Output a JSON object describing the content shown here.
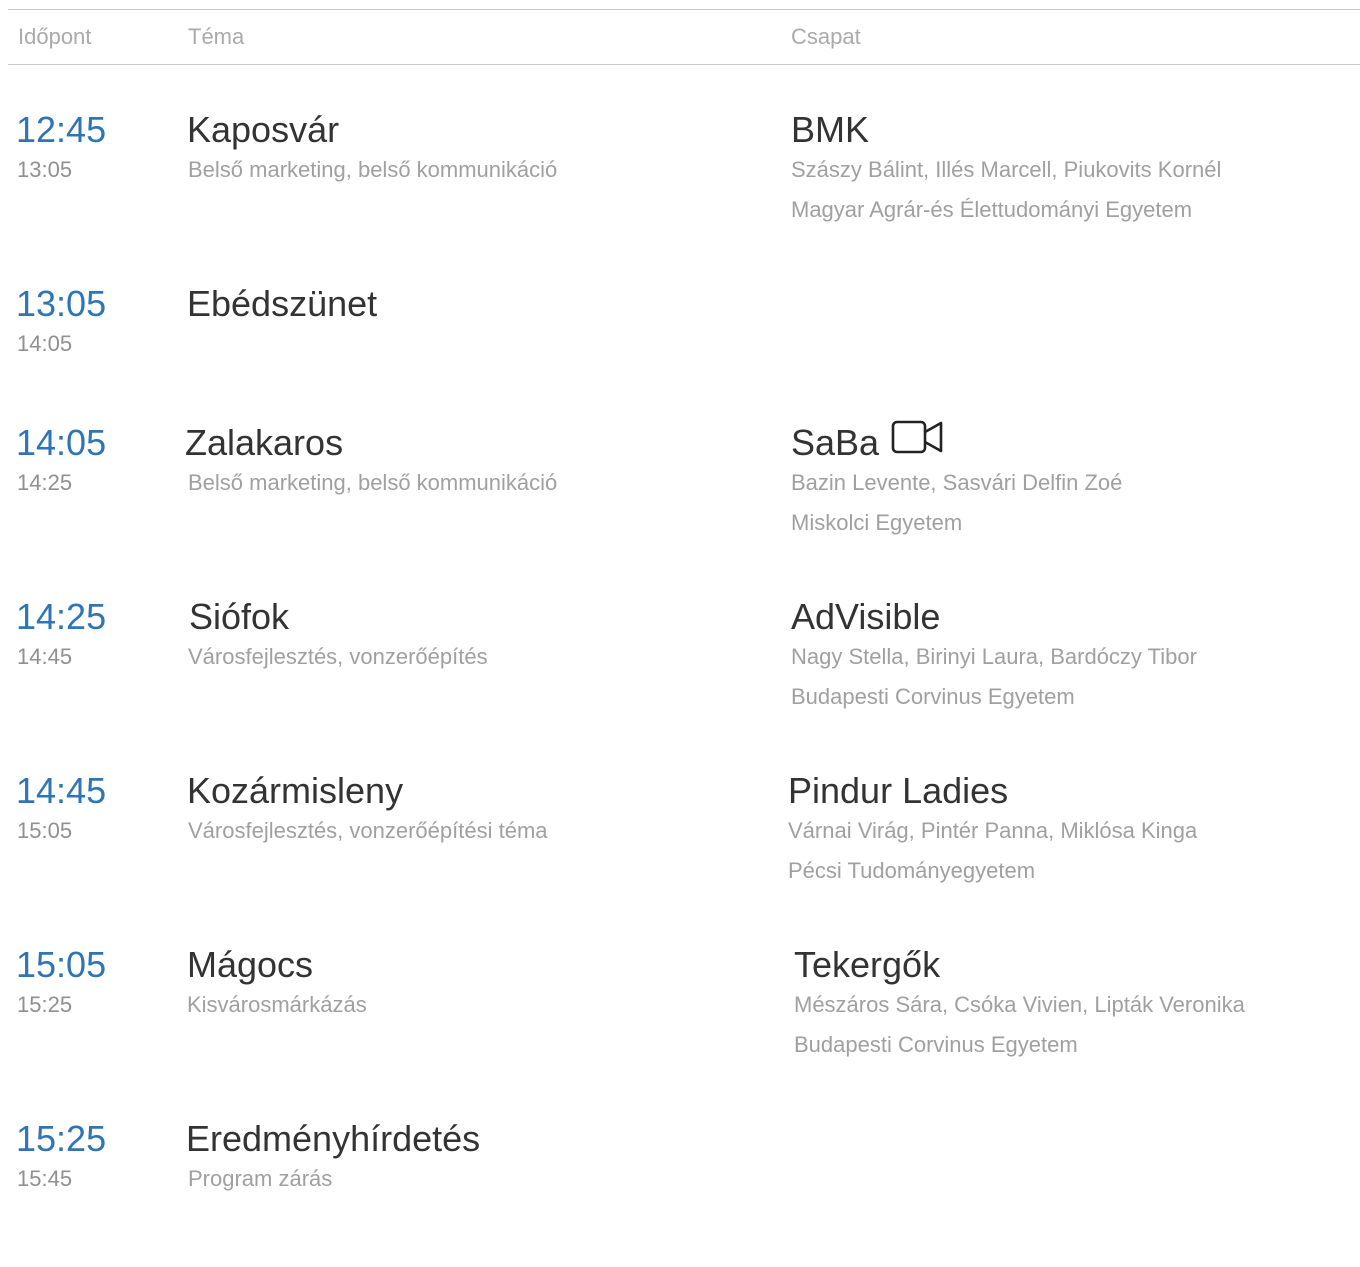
{
  "header": {
    "time_label": "Időpont",
    "topic_label": "Téma",
    "team_label": "Csapat"
  },
  "rows": [
    {
      "start": "12:45",
      "end": "13:05",
      "title": "Kaposvár",
      "subtitle": "Belső marketing, belső kommunikáció",
      "team": "BMK",
      "members": "Szászy Bálint, Illés Marcell,  Piukovits Kornél",
      "university": "Magyar Agrár-és Élettudományi Egyetem"
    },
    {
      "start": "13:05",
      "end": "14:05",
      "title": "Ebédszünet"
    },
    {
      "start": "14:05",
      "end": "14:25",
      "title": "Zalakaros",
      "subtitle": "Belső marketing, belső kommunikáció",
      "team": "SaBa",
      "team_icon": "video-camera-icon",
      "members": "Bazin Levente, Sasvári Delfin Zoé",
      "university": "Miskolci Egyetem"
    },
    {
      "start": "14:25",
      "end": "14:45",
      "title": "Siófok",
      "subtitle": "Városfejlesztés, vonzerőépítés",
      "team": "AdVisible",
      "members": "Nagy Stella, Birinyi Laura, Bardóczy Tibor",
      "university": "Budapesti Corvinus Egyetem"
    },
    {
      "start": "14:45",
      "end": "15:05",
      "title": "Kozármisleny",
      "subtitle": "Városfejlesztés, vonzerőépítési téma",
      "team": "Pindur Ladies",
      "members": "Várnai Virág, Pintér Panna, Miklósa Kinga",
      "university": "Pécsi Tudományegyetem"
    },
    {
      "start": "15:05",
      "end": "15:25",
      "title": "Mágocs",
      "subtitle": "Kisvárosmárkázás",
      "team": "Tekergők",
      "members": "Mészáros Sára, Csóka Vivien, Lipták Veronika",
      "university": "Budapesti Corvinus Egyetem"
    },
    {
      "start": "15:25",
      "end": "15:45",
      "title": "Eredményhírdetés",
      "subtitle": "Program zárás"
    }
  ],
  "colors": {
    "time_accent": "#2e75b6",
    "heading_text": "#333333",
    "muted_text": "#a0a0a0"
  }
}
